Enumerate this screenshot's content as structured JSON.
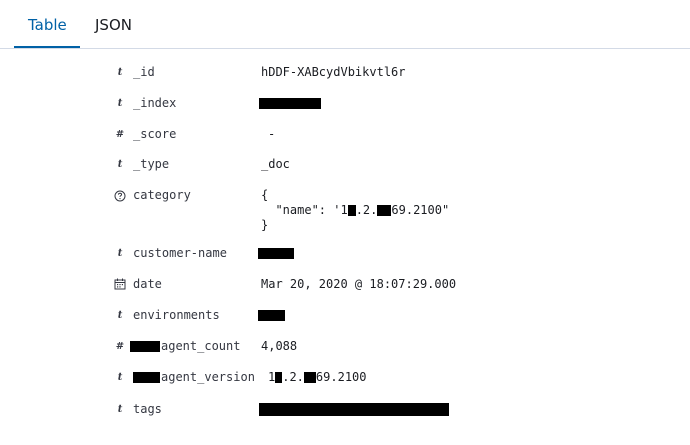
{
  "tabs": [
    {
      "label": "Table",
      "active": true
    },
    {
      "label": "JSON",
      "active": false
    }
  ],
  "colors": {
    "accent": "#0061a6",
    "text": "#1a1c21",
    "muted": "#343741",
    "border": "#d3dae6"
  },
  "fields": [
    {
      "type_icon": "t",
      "name": "_id",
      "value": "hDDF-XABcydVbikvtl6r"
    },
    {
      "type_icon": "t",
      "name": "_index",
      "value": ""
    },
    {
      "type_icon": "#",
      "name": "_score",
      "value": "-"
    },
    {
      "type_icon": "t",
      "name": "_type",
      "value": "_doc"
    },
    {
      "type_icon": "?",
      "name": "category",
      "value_lines": [
        "{",
        "  \"name\": '1",
        ".2.",
        "69.2100\"",
        "}"
      ]
    },
    {
      "type_icon": "t",
      "name": "customer-name",
      "value": ""
    },
    {
      "type_icon": "calendar",
      "name": "date",
      "value": "Mar 20, 2020 @ 18:07:29.000"
    },
    {
      "type_icon": "t",
      "name": "environments",
      "value": ""
    },
    {
      "type_icon": "#",
      "name": "agent_count",
      "value": "4,088"
    },
    {
      "type_icon": "t",
      "name": "agent_version",
      "value_parts": [
        "1",
        ".2.",
        "69.2100"
      ]
    },
    {
      "type_icon": "t",
      "name": "tags",
      "value": ""
    }
  ]
}
